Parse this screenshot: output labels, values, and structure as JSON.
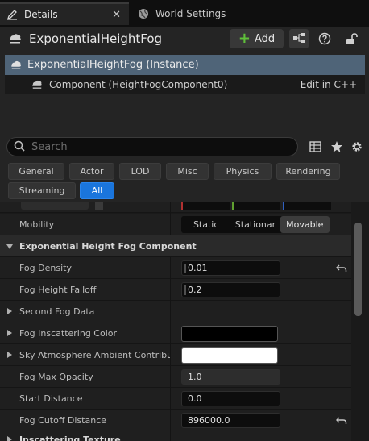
{
  "tabs": {
    "details": "Details",
    "world_settings": "World Settings"
  },
  "header": {
    "title": "ExponentialHeightFog",
    "add_label": "Add"
  },
  "tree": {
    "root": "ExponentialHeightFog (Instance)",
    "child": "Component (HeightFogComponent0)",
    "edit_link": "Edit in C++"
  },
  "search": {
    "placeholder": "Search"
  },
  "filters": {
    "general": "General",
    "actor": "Actor",
    "lod": "LOD",
    "misc": "Misc",
    "physics": "Physics",
    "rendering": "Rendering",
    "streaming": "Streaming",
    "all": "All"
  },
  "mobility": {
    "label": "Mobility",
    "options": [
      "Static",
      "Stationar",
      "Movable"
    ],
    "selected": "Movable"
  },
  "section": {
    "title": "Exponential Height Fog Component"
  },
  "properties": {
    "fog_density": {
      "label": "Fog Density",
      "value": "0.01"
    },
    "fog_height_falloff": {
      "label": "Fog Height Falloff",
      "value": "0.2"
    },
    "second_fog_data": {
      "label": "Second Fog Data"
    },
    "fog_inscattering_color": {
      "label": "Fog Inscattering Color",
      "color": "#000000"
    },
    "sky_atmosphere": {
      "label": "Sky Atmosphere Ambient Contributi",
      "color": "#ffffff"
    },
    "fog_max_opacity": {
      "label": "Fog Max Opacity",
      "value": "1.0"
    },
    "start_distance": {
      "label": "Start Distance",
      "value": "0.0"
    },
    "fog_cutoff_distance": {
      "label": "Fog Cutoff Distance",
      "value": "896000.0"
    },
    "inscattering_texture": {
      "label": "Inscattering Texture"
    }
  },
  "colors": {
    "accent": "#1a75dc",
    "selection": "#4f6478",
    "add_plus": "#5fbf3a"
  }
}
